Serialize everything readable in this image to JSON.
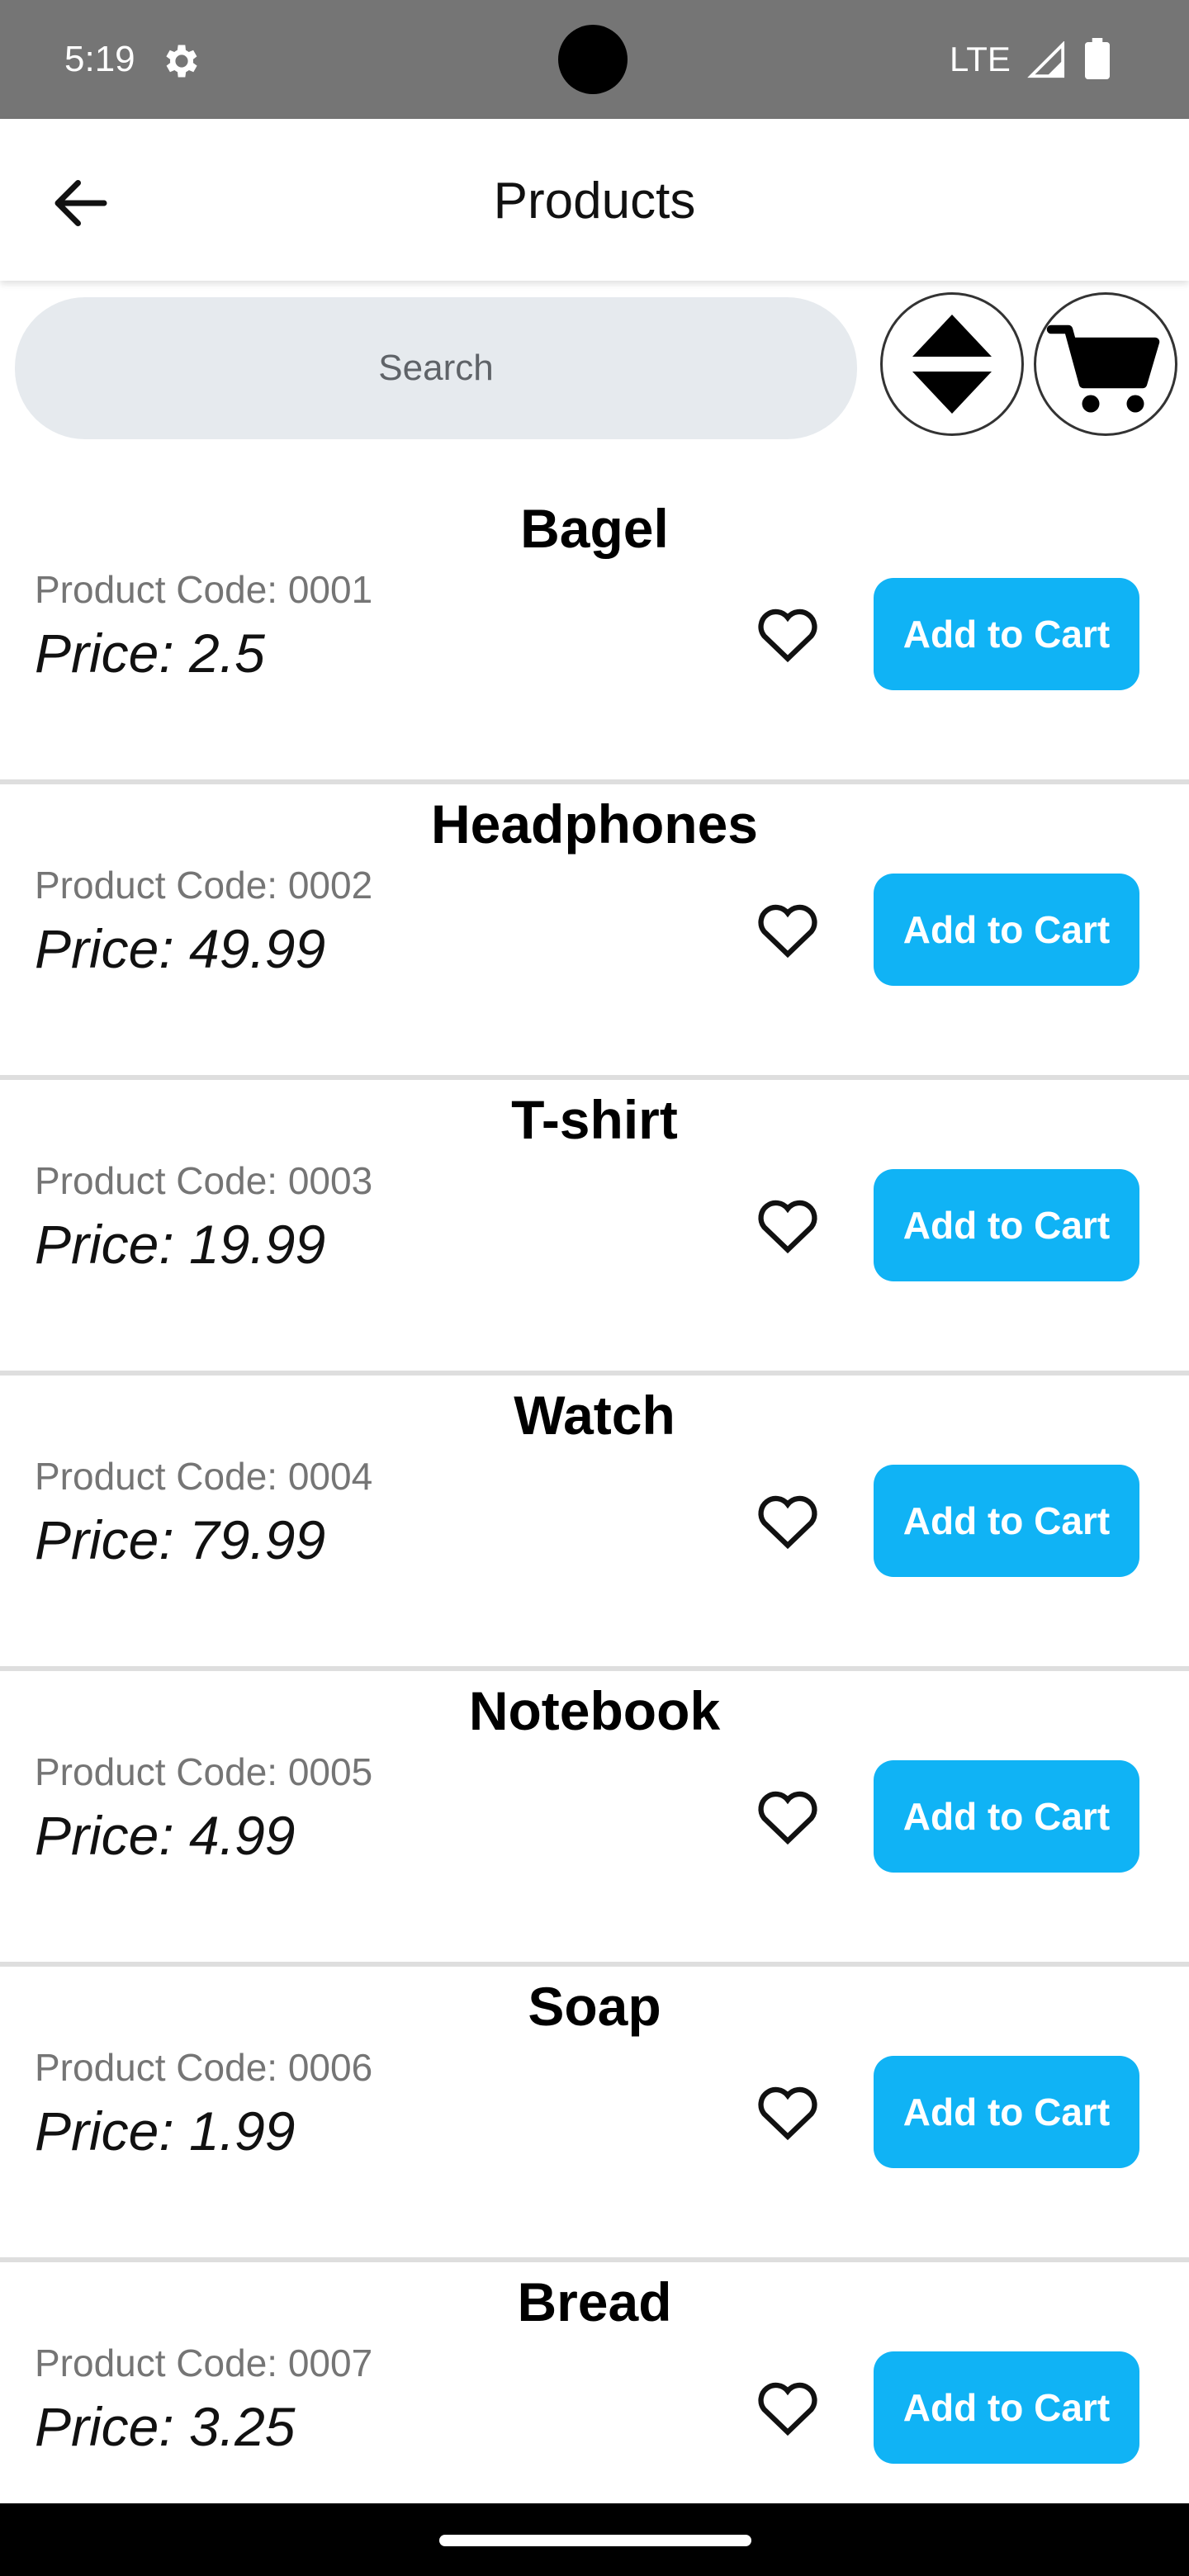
{
  "status_bar": {
    "time": "5:19",
    "network": "LTE"
  },
  "app_bar": {
    "title": "Products"
  },
  "search": {
    "placeholder": "Search"
  },
  "products": [
    {
      "name": "Bagel",
      "code": "Product Code: 0001",
      "price": "Price: 2.5",
      "add_label": "Add to Cart"
    },
    {
      "name": "Headphones",
      "code": "Product Code: 0002",
      "price": "Price: 49.99",
      "add_label": "Add to Cart"
    },
    {
      "name": "T-shirt",
      "code": "Product Code: 0003",
      "price": "Price: 19.99",
      "add_label": "Add to Cart"
    },
    {
      "name": "Watch",
      "code": "Product Code: 0004",
      "price": "Price: 79.99",
      "add_label": "Add to Cart"
    },
    {
      "name": "Notebook",
      "code": "Product Code: 0005",
      "price": "Price: 4.99",
      "add_label": "Add to Cart"
    },
    {
      "name": "Soap",
      "code": "Product Code: 0006",
      "price": "Price: 1.99",
      "add_label": "Add to Cart"
    },
    {
      "name": "Bread",
      "code": "Product Code: 0007",
      "price": "Price: 3.25",
      "add_label": "Add to Cart"
    }
  ],
  "icons": {
    "back": "arrow-back-icon",
    "sort": "sort-icon",
    "cart": "cart-icon",
    "favorite": "heart-outline-icon",
    "settings": "gear-icon",
    "signal": "signal-icon",
    "battery": "battery-icon"
  },
  "colors": {
    "status_bar": "#757575",
    "accent": "#10b3f5",
    "search_bg": "#e6eaee",
    "divider": "#dedede",
    "code_text": "#757575"
  }
}
